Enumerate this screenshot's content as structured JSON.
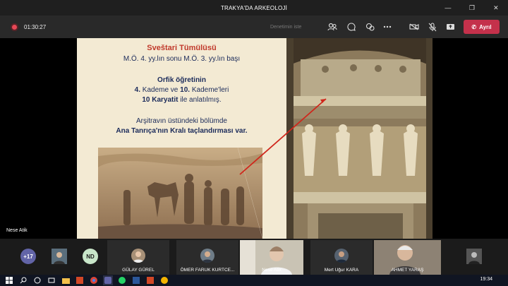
{
  "window": {
    "title": "TRAKYA'DA ARKEOLOJİ"
  },
  "toolbar": {
    "timer": "01:30:27",
    "control_text": "Denetimin iste",
    "leave_label": "Ayrıl"
  },
  "slide": {
    "title": "Sveštari Tümülüsü",
    "subtitle": "M.Ö. 4. yy.lın sonu M.Ö. 3. yy.lın başı",
    "line1": "Orfik öğretinin",
    "line2_a": "4.",
    "line2_b": " Kademe ve ",
    "line2_c": "10.",
    "line2_d": " Kademe'leri",
    "line3_a": "10 Karyatit",
    "line3_b": " ile anlatılmış.",
    "line4": "Arşitravın üstündeki bölümde",
    "line5_a": "Ana Tanrıça'nın",
    "line5_b": " Kralı taçlandırması var."
  },
  "presenter": "Nese Atik",
  "participants": {
    "overflow": "+17",
    "nd": "ND",
    "tiles": [
      {
        "name": "GÜLAY GÜREL"
      },
      {
        "name": "ÖMER FARUK KURTCE..."
      },
      {
        "name": "Nese Atik"
      },
      {
        "name": "Mert Uğur KARA"
      },
      {
        "name": "AHMET YARAŞ"
      }
    ]
  },
  "taskbar": {
    "time": "19:34"
  },
  "colors": {
    "leave": "#c4314b",
    "record": "#e74856",
    "slide_title": "#c0392b",
    "slide_text": "#1a2a5a"
  }
}
